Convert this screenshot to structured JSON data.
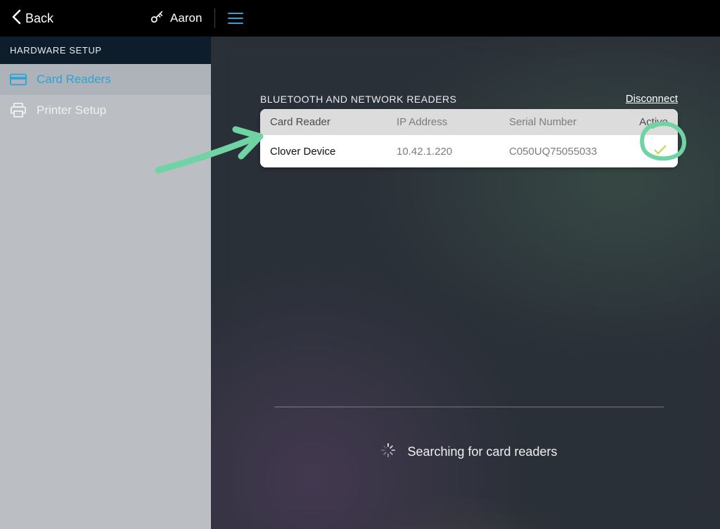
{
  "topbar": {
    "back_label": "Back",
    "username": "Aaron"
  },
  "sidebar": {
    "heading": "HARDWARE SETUP",
    "items": [
      {
        "label": "Card Readers",
        "icon": "card-reader-icon",
        "active": true
      },
      {
        "label": "Printer Setup",
        "icon": "printer-icon",
        "active": false
      }
    ]
  },
  "main": {
    "section_title": "BLUETOOTH AND NETWORK READERS",
    "disconnect_label": "Disconnect",
    "columns": {
      "name": "Card Reader",
      "ip": "IP Address",
      "serial": "Serial Number",
      "active": "Active"
    },
    "rows": [
      {
        "name": "Clover Device",
        "ip": "10.42.1.220",
        "serial": "C050UQ75055033",
        "active": true
      }
    ],
    "searching_label": "Searching for card readers"
  },
  "colors": {
    "accent": "#2ea3d6",
    "annotation": "#6fd3a4"
  }
}
